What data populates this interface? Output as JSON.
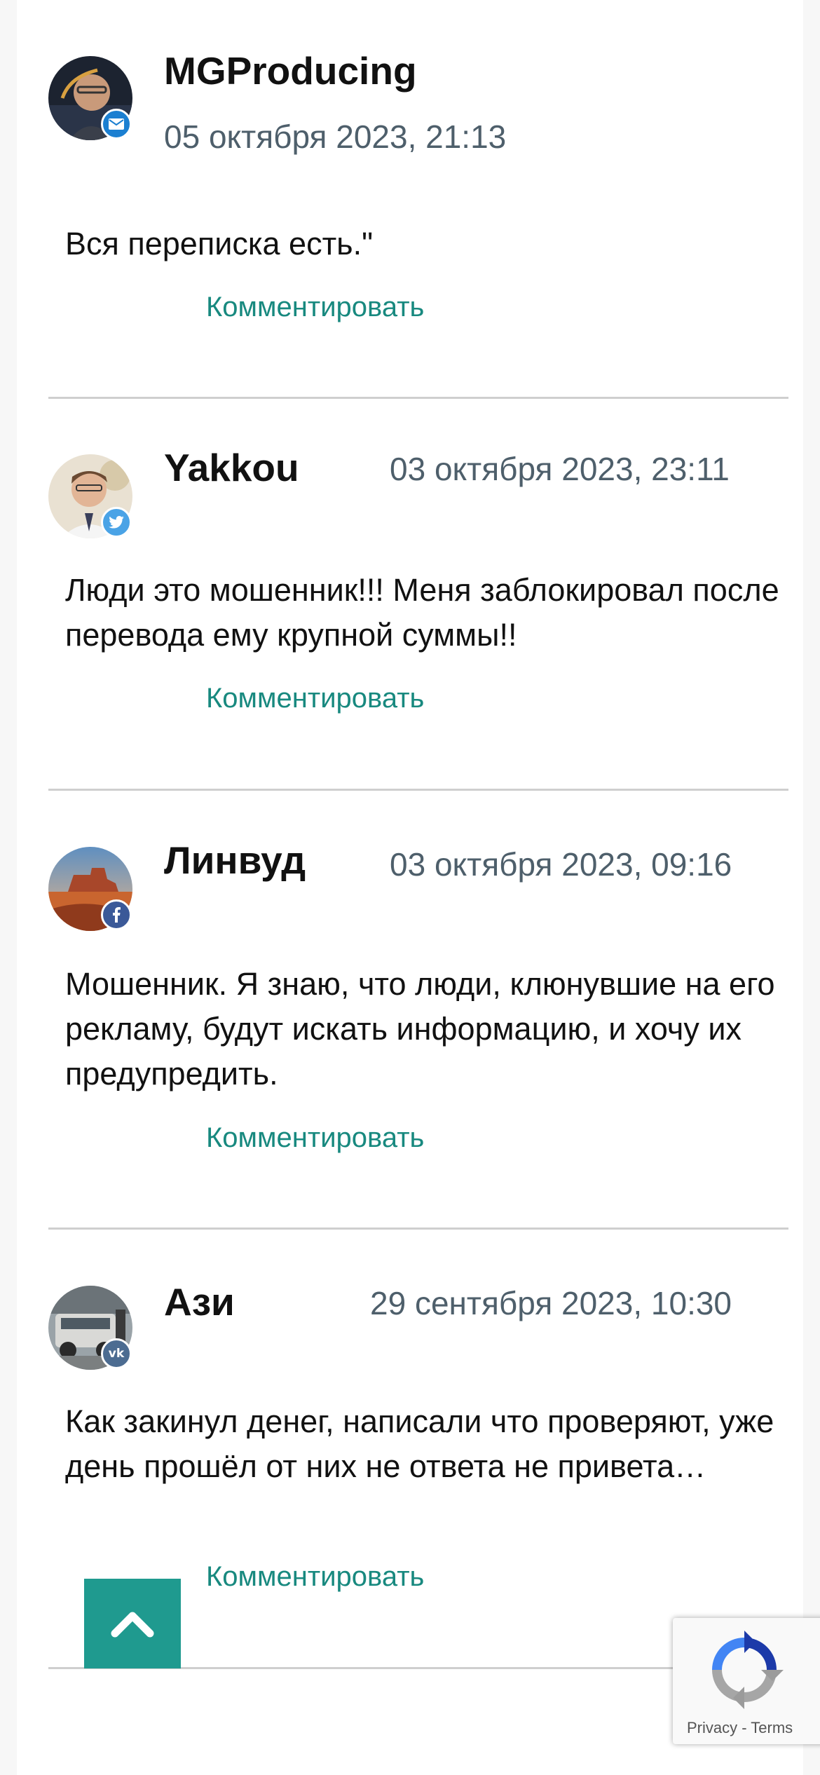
{
  "comments": [
    {
      "author": "MGProducing",
      "date": "05 октября 2023, 21:13",
      "text": "Вся переписка есть.\"",
      "reply_label": "Комментировать",
      "badge_icon": "mail-icon",
      "badge_color": "#1b7fd1"
    },
    {
      "author": "Yakkou",
      "date": "03 октября 2023, 23:11",
      "text": "Люди это мошенник!!! Меня заблокировал после перевода ему крупной суммы!!",
      "reply_label": "Комментировать",
      "badge_icon": "twitter-icon",
      "badge_color": "#4aa3e6"
    },
    {
      "author": "Линвуд",
      "date": "03 октября 2023, 09:16",
      "text": "Мошенник. Я знаю, что люди, клюнувшие на его рекламу, будут искать информацию, и хочу их предупредить.",
      "reply_label": "Комментировать",
      "badge_icon": "facebook-icon",
      "badge_color": "#3b5998"
    },
    {
      "author": "Ази",
      "date": "29 сентября 2023, 10:30",
      "text": "Как закинул денег, написали что проверяют, уже день прошёл от них не ответа не привета…",
      "reply_label": "Комментировать",
      "badge_icon": "vk-icon",
      "badge_color": "#4c6c91"
    }
  ],
  "scroll_top": {
    "icon": "chevron-up-icon",
    "color": "#1f9a8f"
  },
  "recaptcha": {
    "privacy": "Privacy",
    "separator": " - ",
    "terms": "Terms"
  }
}
